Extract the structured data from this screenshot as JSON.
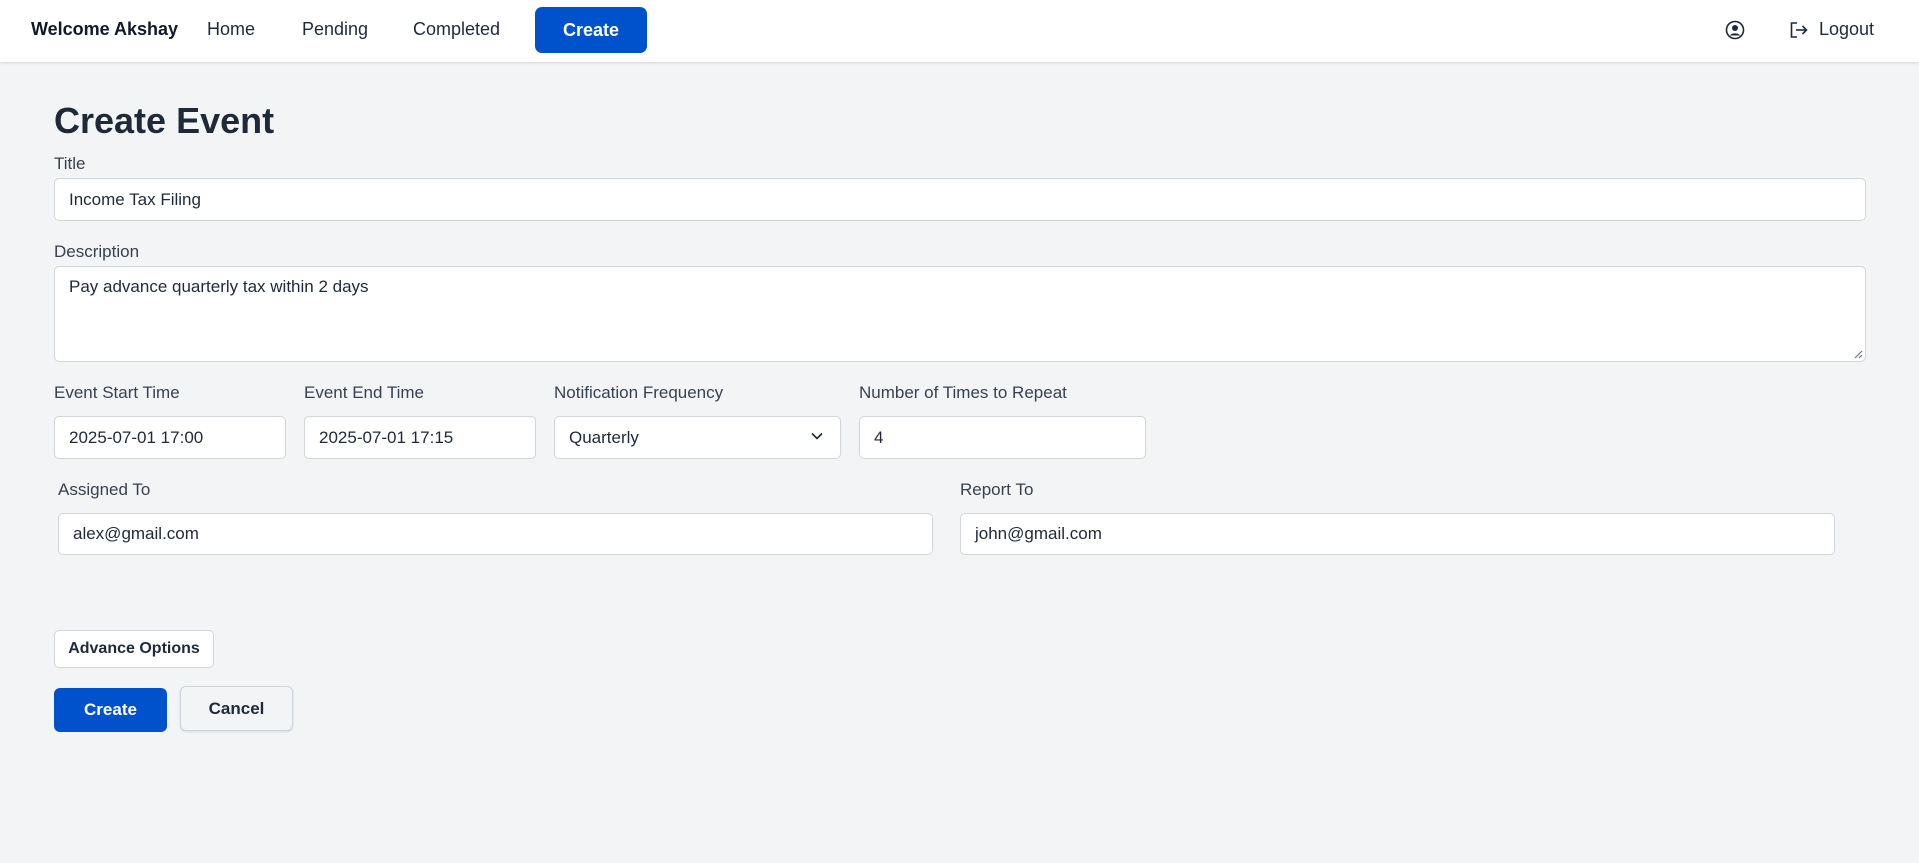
{
  "navbar": {
    "welcome": "Welcome Akshay",
    "links": [
      "Home",
      "Pending",
      "Completed"
    ],
    "create_label": "Create",
    "logout_label": "Logout"
  },
  "page": {
    "title": "Create Event"
  },
  "form": {
    "title_label": "Title",
    "title_value": "Income Tax Filing",
    "description_label": "Description",
    "description_value": "Pay advance quarterly tax within 2 days",
    "start_label": "Event Start Time",
    "start_value": "2025-07-01 17:00",
    "end_label": "Event End Time",
    "end_value": "2025-07-01 17:15",
    "frequency_label": "Notification Frequency",
    "frequency_value": "Quarterly",
    "repeat_label": "Number of Times to Repeat",
    "repeat_value": "4",
    "assigned_label": "Assigned To",
    "assigned_value": "alex@gmail.com",
    "report_label": "Report To",
    "report_value": "john@gmail.com",
    "advance_label": "Advance Options",
    "create_label": "Create",
    "cancel_label": "Cancel"
  },
  "colors": {
    "primary": "#0052cc",
    "background": "#f3f4f6"
  },
  "icons": {
    "profile": "user-circle-icon",
    "logout": "logout-icon",
    "select": "chevron-down-icon"
  }
}
